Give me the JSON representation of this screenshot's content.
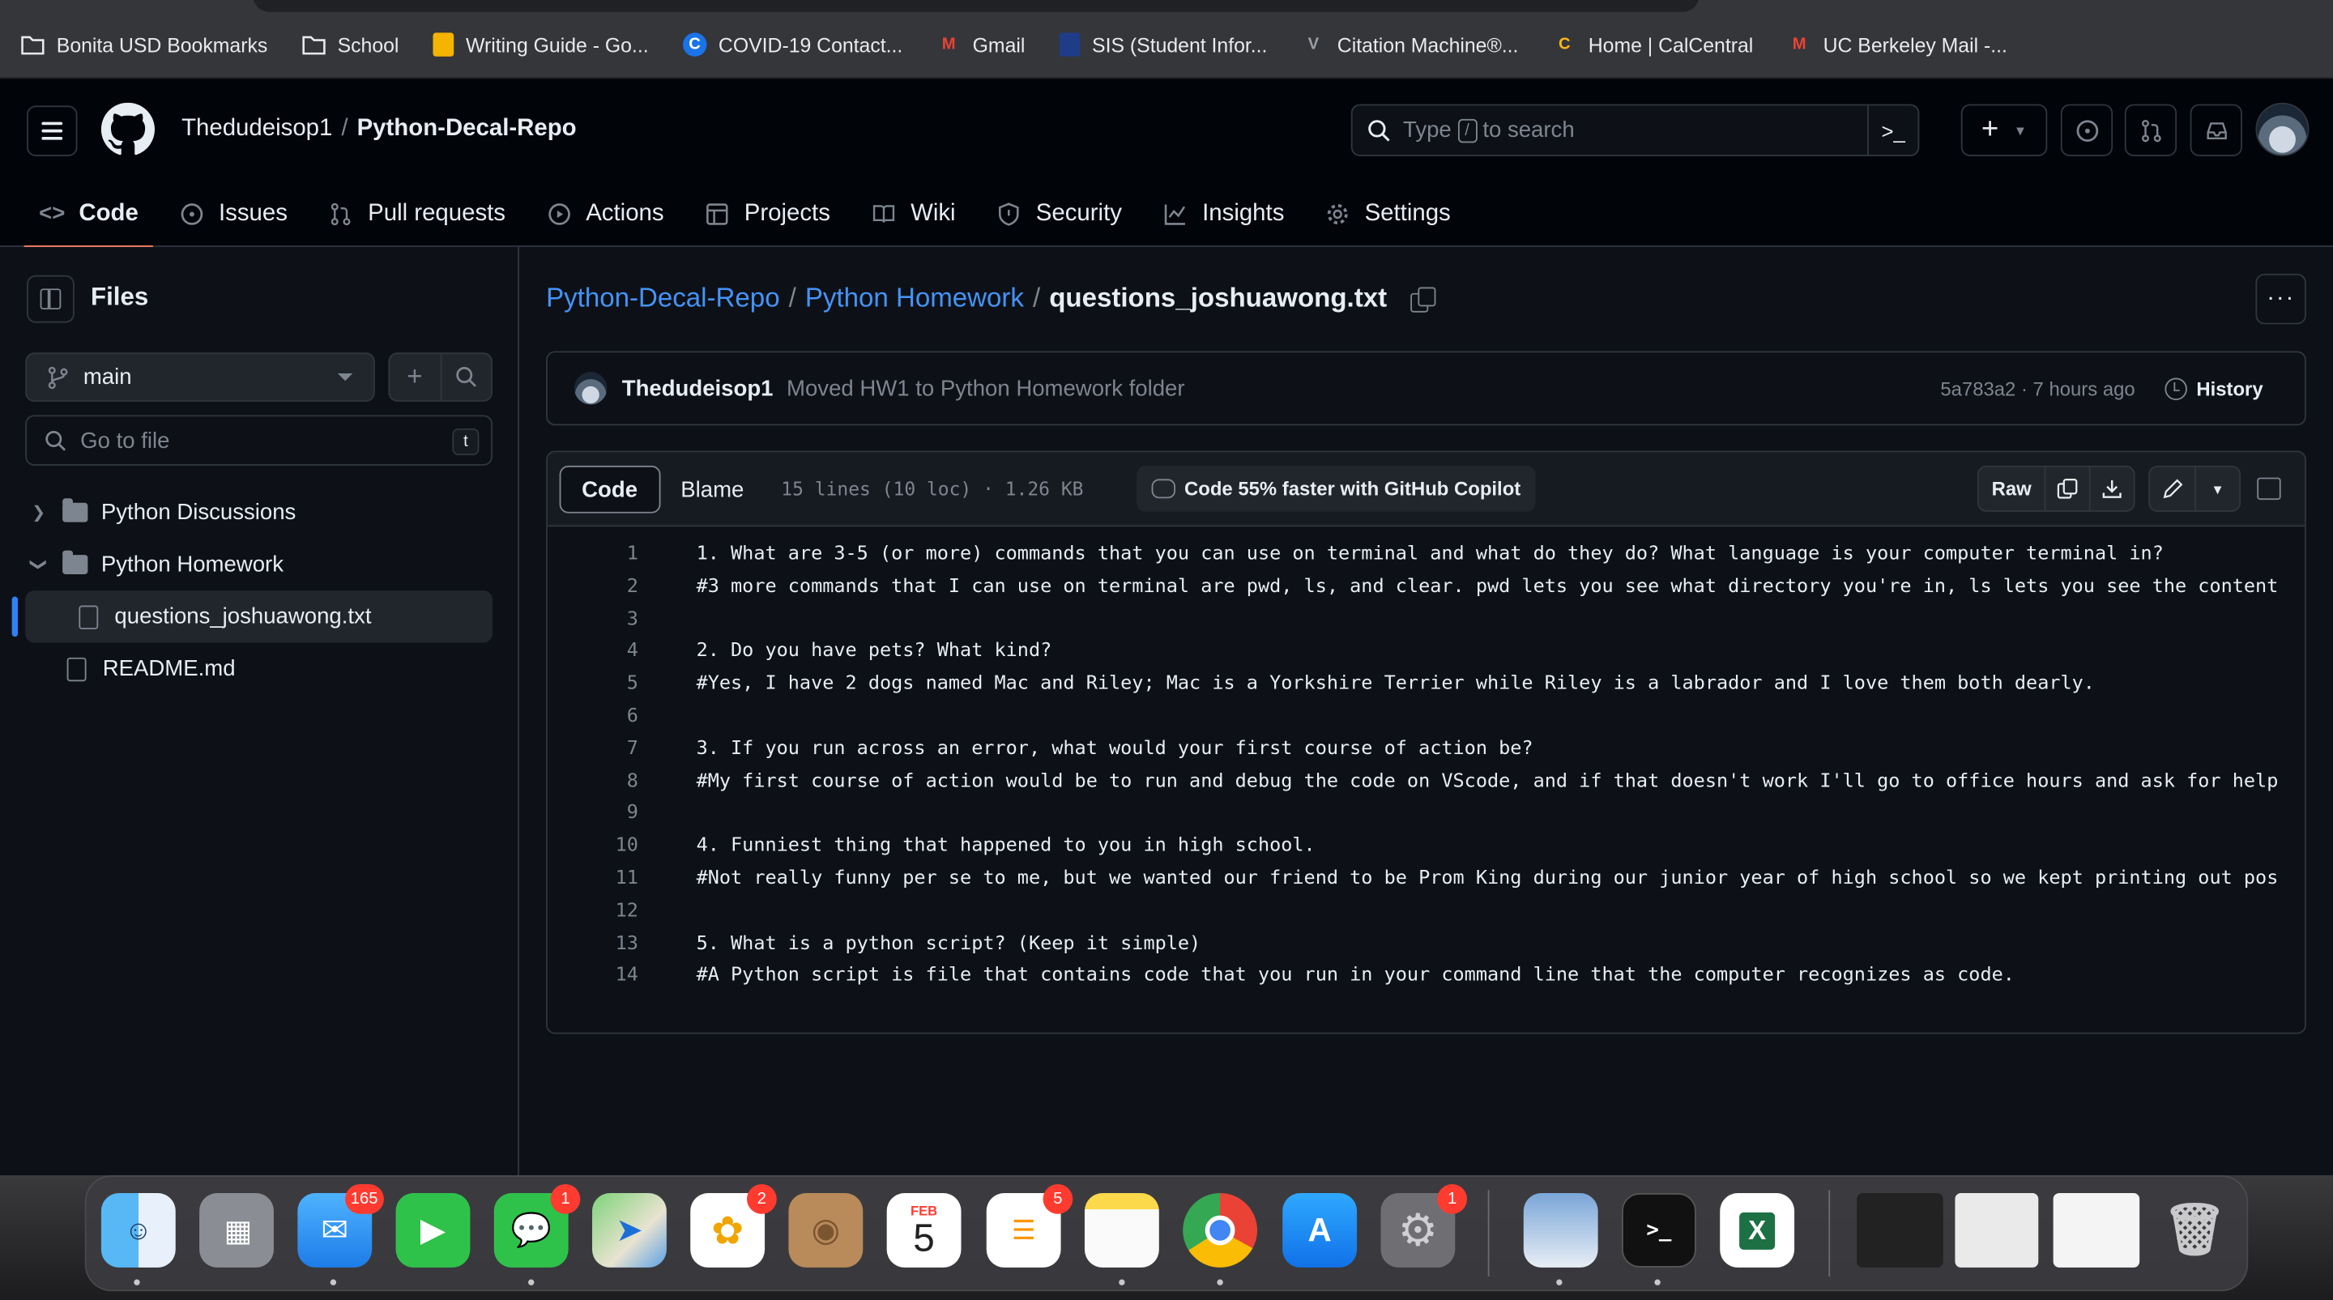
{
  "bookmarks": [
    {
      "label": "Bonita USD Bookmarks",
      "icon": "folder-icon"
    },
    {
      "label": "School",
      "icon": "folder-icon"
    },
    {
      "label": "Writing Guide - Go...",
      "icon": "doc-icon"
    },
    {
      "label": "COVID-19 Contact...",
      "icon": "c-icon"
    },
    {
      "label": "Gmail",
      "icon": "gmail-icon"
    },
    {
      "label": "SIS (Student Infor...",
      "icon": "shield-icon"
    },
    {
      "label": "Citation Machine®...",
      "icon": "citation-icon"
    },
    {
      "label": "Home | CalCentral",
      "icon": "calcentral-icon"
    },
    {
      "label": "UC Berkeley Mail -...",
      "icon": "gmail-icon"
    }
  ],
  "header": {
    "owner": "Thedudeisop1",
    "separator": "/",
    "repo": "Python-Decal-Repo",
    "search_pre": "Type",
    "search_key": "/",
    "search_post": "to search"
  },
  "tabs": [
    {
      "label": "Code",
      "icon": "code-icon",
      "active": true
    },
    {
      "label": "Issues",
      "icon": "issue-icon"
    },
    {
      "label": "Pull requests",
      "icon": "pull-request-icon"
    },
    {
      "label": "Actions",
      "icon": "play-icon"
    },
    {
      "label": "Projects",
      "icon": "table-icon"
    },
    {
      "label": "Wiki",
      "icon": "book-icon"
    },
    {
      "label": "Security",
      "icon": "shield-icon"
    },
    {
      "label": "Insights",
      "icon": "graph-icon"
    },
    {
      "label": "Settings",
      "icon": "gear-icon"
    }
  ],
  "sidebar": {
    "title": "Files",
    "branch": "main",
    "goto_placeholder": "Go to file",
    "goto_key": "t",
    "tree": [
      {
        "label": "Python Discussions",
        "type": "folder",
        "expanded": false
      },
      {
        "label": "Python Homework",
        "type": "folder",
        "expanded": true
      },
      {
        "label": "questions_joshuawong.txt",
        "type": "file",
        "selected": true
      },
      {
        "label": "README.md",
        "type": "file"
      }
    ]
  },
  "breadcrumb": {
    "root": "Python-Decal-Repo",
    "folder": "Python Homework",
    "file": "questions_joshuawong.txt",
    "sep": "/"
  },
  "commit": {
    "author": "Thedudeisop1",
    "message": "Moved HW1 to Python Homework folder",
    "meta": "5a783a2 · 7 hours ago",
    "history": "History"
  },
  "viewer": {
    "code_tab": "Code",
    "blame_tab": "Blame",
    "info": "15 lines (10 loc) · 1.26 KB",
    "copilot": "Code 55% faster with GitHub Copilot",
    "raw": "Raw"
  },
  "lines": [
    "1. What are 3-5 (or more) commands that you can use on terminal and what do they do? What language is your computer terminal in?",
    "#3 more commands that I can use on terminal are pwd, ls, and clear. pwd lets you see what directory you're in, ls lets you see the content",
    "",
    "2. Do you have pets? What kind?",
    "#Yes, I have 2 dogs named Mac and Riley; Mac is a Yorkshire Terrier while Riley is a labrador and I love them both dearly.",
    "",
    "3. If you run across an error, what would your first course of action be?",
    "#My first course of action would be to run and debug the code on VScode, and if that doesn't work I'll go to office hours and ask for help",
    "",
    "4. Funniest thing that happened to you in high school.",
    "#Not really funny per se to me, but we wanted our friend to be Prom King during our junior year of high school so we kept printing out pos",
    "",
    "5. What is a python script? (Keep it simple)",
    "#A Python script is file that contains code that you run in your command line that the computer recognizes as code."
  ],
  "dock": {
    "mail_badge": "165",
    "messages_badge": "1",
    "photos_badge": "2",
    "calendar_month": "FEB",
    "calendar_day": "5",
    "reminders_badge": "5",
    "settings_badge": "1"
  }
}
